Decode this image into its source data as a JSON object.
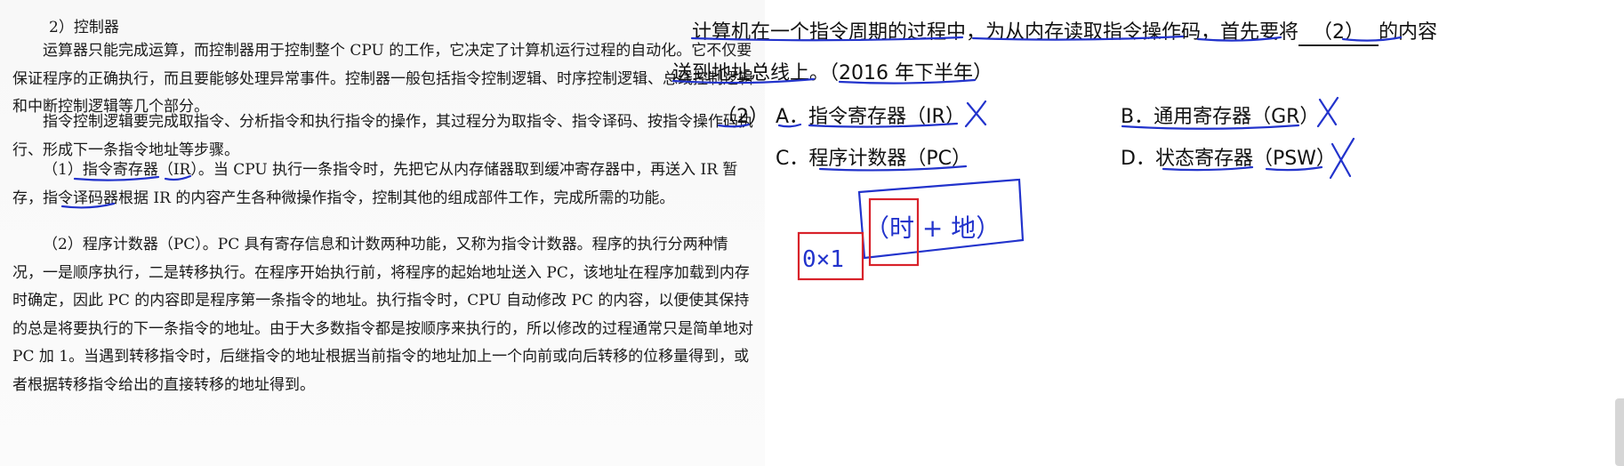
{
  "left": {
    "heading": "2）控制器",
    "p1": "运算器只能完成运算，而控制器用于控制整个 CPU 的工作，它决定了计算机运行过程的自动化。它不仅要保证程序的正确执行，而且要能够处理异常事件。控制器一般包括指令控制逻辑、时序控制逻辑、总线控制逻辑和中断控制逻辑等几个部分。",
    "p2": "指令控制逻辑要完成取指令、分析指令和执行指令的操作，其过程分为取指令、指令译码、按指令操作码执行、形成下一条指令地址等步骤。",
    "p3": "（1）指令寄存器（IR）。当 CPU 执行一条指令时，先把它从内存储器取到缓冲寄存器中，再送入 IR 暂存，指令译码器根据 IR 的内容产生各种微操作指令，控制其他的组成部件工作，完成所需的功能。",
    "p4": "（2）程序计数器（PC）。PC 具有寄存信息和计数两种功能，又称为指令计数器。程序的执行分两种情况，一是顺序执行，二是转移执行。在程序开始执行前，将程序的起始地址送入 PC，该地址在程序加载到内存时确定，因此 PC 的内容即是程序第一条指令的地址。执行指令时，CPU 自动修改 PC 的内容，以便使其保持的总是将要执行的下一条指令的地址。由于大多数指令都是按顺序来执行的，所以修改的过程通常只是简单地对 PC 加 1。当遇到转移指令时，后继指令的地址根据当前指令的地址加上一个向前或向后转移的位移量得到，或者根据转移指令给出的直接转移的地址得到。"
  },
  "question": {
    "line1_pre": "计算机在一个指令周期的过程中，为从内存读取指令操作码，首先要将",
    "blank": "（2）",
    "line1_post": "的内容",
    "line2": "送到地址总线上。（2016 年下半年）",
    "number": "（2）",
    "options": {
      "a": "A．指令寄存器（IR）",
      "b": "B．通用寄存器（GR）",
      "c": "C．程序计数器（PC）",
      "d": "D．状态寄存器（PSW）"
    }
  },
  "annotations": {
    "box_text": "0×1",
    "paren_text": "（时 + 地）",
    "ink_blue": "#2233cc",
    "ink_red": "#d8222a"
  }
}
